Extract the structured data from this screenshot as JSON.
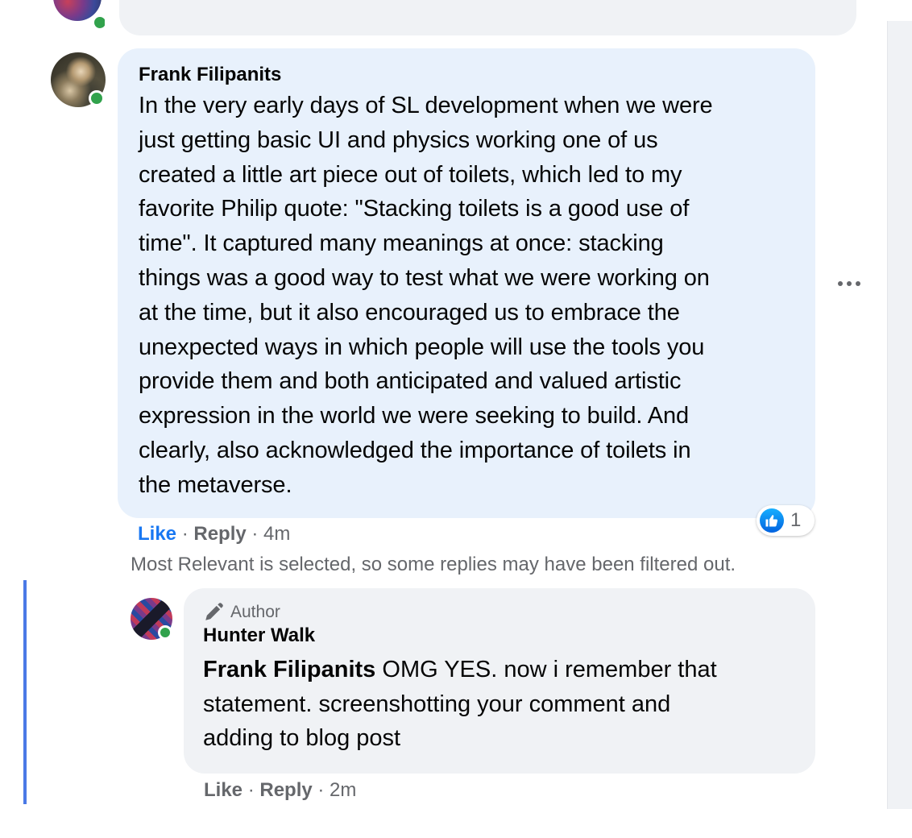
{
  "previous_comment": {},
  "comment": {
    "author": "Frank Filipanits",
    "text": "In the very early days of SL development when we were\njust getting basic UI and physics working one of us\ncreated a little art piece out of toilets, which led to my\nfavorite Philip quote: \"Stacking toilets is a good use of\ntime\". It captured many meanings at once: stacking\nthings was a good way to test what we were working on\nat the time, but it also encouraged us to embrace the\nunexpected ways in which people will use the tools you\nprovide them and both anticipated and valued artistic\nexpression in the world we were seeking to build. And\nclearly, also acknowledged the importance of toilets in\nthe metaverse.",
    "like_label": "Like",
    "reply_label": "Reply",
    "sep": " · ",
    "time": "4m",
    "reaction_count": "1",
    "like_icon": "thumbs-up-icon"
  },
  "filter_note": "Most Relevant is selected, so some replies may have been filtered out.",
  "reply": {
    "badge": "Author",
    "badge_icon": "pencil-icon",
    "author": "Hunter Walk",
    "mention": "Frank Filipanits",
    "text": " OMG YES. now i remember that\nstatement. screenshotting your comment and\nadding to blog post",
    "like_label": "Like",
    "reply_label": "Reply",
    "sep": " · ",
    "time": "2m"
  },
  "colors": {
    "comment_bubble": "#e8f1fc",
    "reply_bubble": "#f0f2f5",
    "link_blue": "#1877f2",
    "thread_line": "#4a79e6",
    "online": "#31a24c"
  }
}
